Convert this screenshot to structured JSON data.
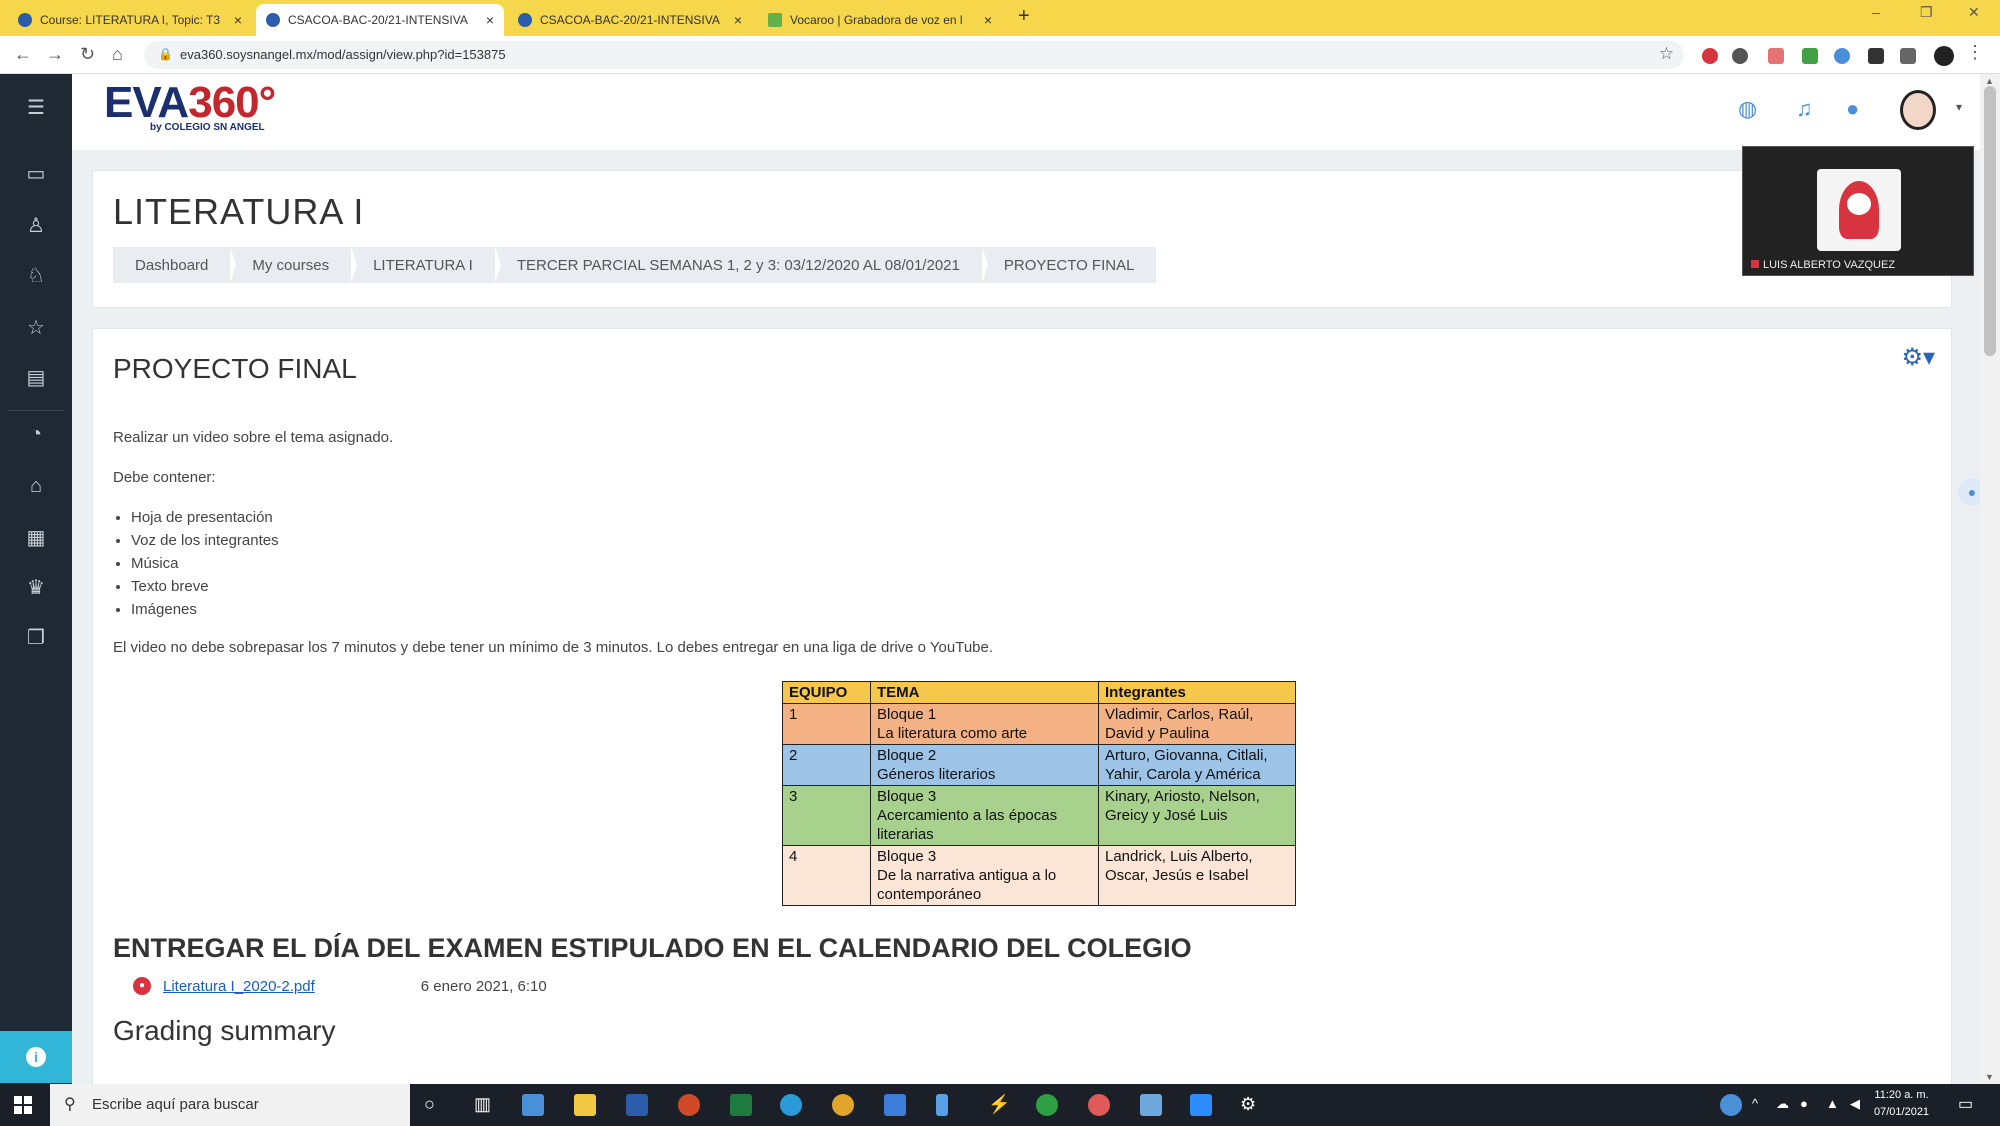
{
  "browser": {
    "tabs": [
      {
        "title": "Course: LITERATURA I, Topic: T3",
        "active": false
      },
      {
        "title": "CSACOA-BAC-20/21-INTENSIVA",
        "active": true
      },
      {
        "title": "CSACOA-BAC-20/21-INTENSIVA",
        "active": false
      },
      {
        "title": "Vocaroo | Grabadora de voz en l",
        "active": false
      }
    ],
    "tab_close": "×",
    "new_tab": "+",
    "window_controls": {
      "minimize": "–",
      "maximize": "❐",
      "close": "✕"
    },
    "url": "eva360.soysnangel.mx/mod/assign/view.php?id=153875"
  },
  "sidebar": {
    "icons": [
      "menu-icon",
      "folder-icon",
      "user-icon",
      "badge-icon",
      "star-icon",
      "book-icon",
      "gauge-icon",
      "home-icon",
      "calendar-icon",
      "graduation-icon",
      "files-icon"
    ]
  },
  "header": {
    "logo_text": "EVA",
    "logo_accent": "360°",
    "logo_sub": "by COLEGIO SN ANGEL"
  },
  "course": {
    "title": "LITERATURA I",
    "breadcrumbs": [
      "Dashboard",
      "My courses",
      "LITERATURA I",
      "TERCER PARCIAL SEMANAS 1, 2 y 3: 03/12/2020 AL 08/01/2021",
      "PROYECTO FINAL"
    ]
  },
  "video": {
    "participant": "LUIS ALBERTO VAZQUEZ"
  },
  "assignment": {
    "title": "PROYECTO FINAL",
    "intro": "Realizar un video sobre el tema asignado.",
    "must_contain_label": "Debe contener:",
    "items": [
      "Hoja de presentación",
      "Voz de los integrantes",
      "Música",
      "Texto breve",
      "Imágenes"
    ],
    "rules": "El video no debe sobrepasar los 7 minutos y debe tener un mínimo de 3 minutos. Lo debes entregar en una liga de drive o YouTube.",
    "table": {
      "headers": [
        "EQUIPO",
        "TEMA",
        "Integrantes"
      ],
      "rows": [
        {
          "equipo": "1",
          "tema": "Bloque 1\nLa literatura como arte",
          "integrantes": "Vladimir, Carlos, Raúl, David y Paulina"
        },
        {
          "equipo": "2",
          "tema": "Bloque 2\nGéneros literarios",
          "integrantes": "Arturo, Giovanna, Citlali, Yahir, Carola y América"
        },
        {
          "equipo": "3",
          "tema": "Bloque 3\nAcercamiento a las épocas literarias",
          "integrantes": "Kinary, Ariosto, Nelson, Greicy y José Luis"
        },
        {
          "equipo": "4",
          "tema": "Bloque 3\nDe la narrativa antigua a lo contemporáneo",
          "integrantes": "Landrick, Luis Alberto, Oscar, Jesús e Isabel"
        }
      ]
    },
    "deadline_heading": "ENTREGAR EL DÍA DEL EXAMEN ESTIPULADO EN EL CALENDARIO DEL COLEGIO",
    "file_name": "Literatura I_2020-2.pdf",
    "file_date": "6 enero 2021, 6:10",
    "grading_heading": "Grading summary"
  },
  "taskbar": {
    "search_placeholder": "Escribe aquí para buscar",
    "time": "11:20 a. m.",
    "date": "07/01/2021"
  },
  "colors": {
    "tabstrip": "#f6d64a",
    "sidebar": "#1f2933",
    "brand_navy": "#1b2f6e",
    "brand_red": "#c4262e",
    "header_row": "#f6c74a",
    "row1": "#f4b183",
    "row2": "#9dc3e6",
    "row3": "#a9d18e",
    "row4": "#fbe5d6"
  }
}
